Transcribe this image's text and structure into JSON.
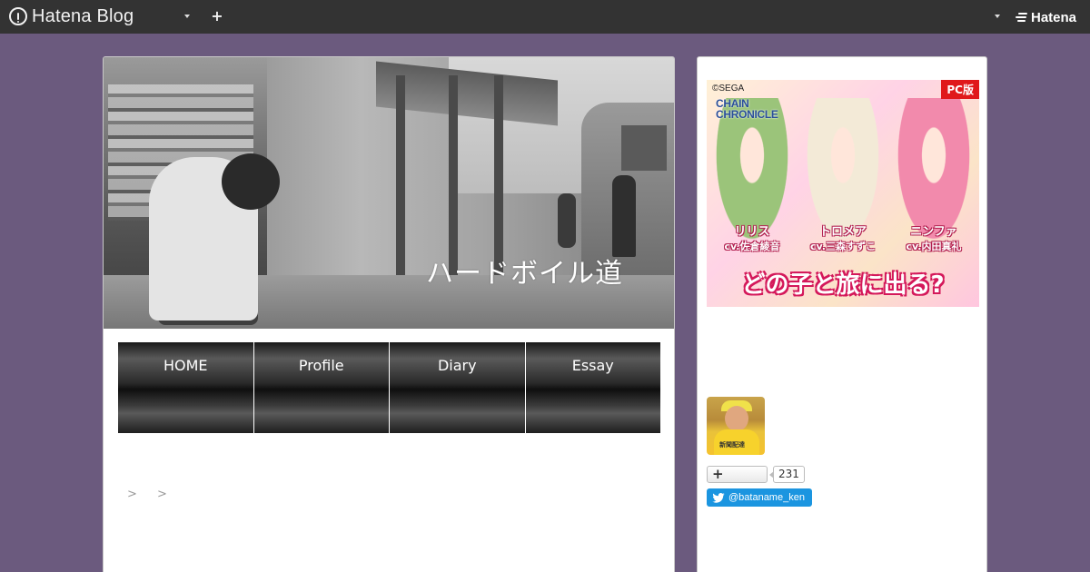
{
  "topbar": {
    "brand": "Hatena Blog",
    "add_label": "+",
    "hatena_label": "Hatena"
  },
  "header": {
    "blog_title": "ハードボイル道"
  },
  "nav": {
    "items": [
      "HOME",
      "Profile",
      "Diary",
      "Essay"
    ]
  },
  "breadcrumb": {
    "separators": [
      ">",
      ">"
    ]
  },
  "sidebar": {
    "ad": {
      "copyright": "©SEGA",
      "game_title": "CHAIN CHRONICLE",
      "platform_badge": "PC版",
      "characters": [
        {
          "name": "リリス",
          "cv": "cv.佐倉綾音"
        },
        {
          "name": "トロメア",
          "cv": "cv.三森すずこ"
        },
        {
          "name": "ニンファ",
          "cv": "cv.内田真礼"
        }
      ],
      "tagline": "どの子と旅に出る?"
    },
    "avatar_shirt_text": "新聞配達",
    "subscribe": {
      "plus": "+",
      "count": "231"
    },
    "twitter": {
      "handle": "@bataname_ken"
    }
  },
  "colors": {
    "background": "#6b5a7e",
    "topbar": "#333333",
    "twitter": "#1b95e0",
    "pc_badge": "#e0191b"
  },
  "icons": [
    "hatena-blog-logo-icon",
    "caret-down-icon",
    "plus-icon",
    "hatena-logo-icon",
    "twitter-bird-icon"
  ]
}
